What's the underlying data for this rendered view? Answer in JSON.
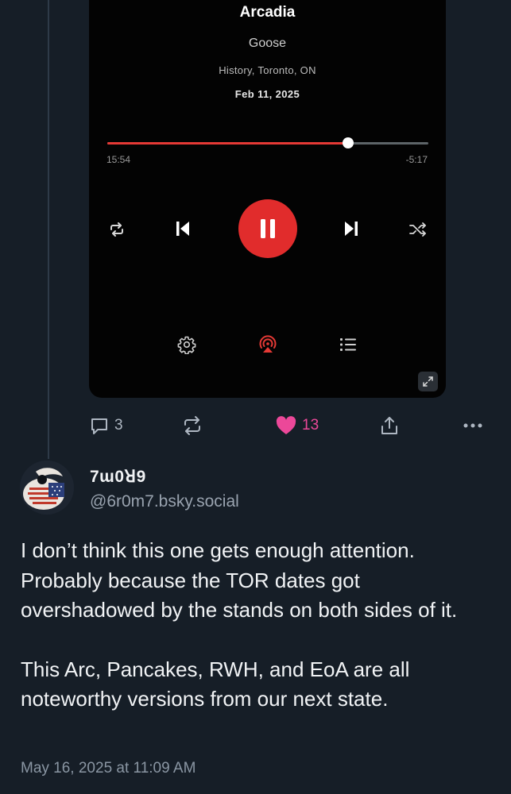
{
  "player": {
    "title": "Arcadia",
    "artist": "Goose",
    "venue": "History, Toronto, ON",
    "date": "Feb 11, 2025",
    "elapsed": "15:54",
    "remaining": "-5:17",
    "progress_fraction": 0.75,
    "playing": true,
    "accent_color": "#e12c2c",
    "controls": [
      "repeat-icon",
      "previous-icon",
      "pause-icon",
      "next-icon",
      "shuffle-icon"
    ],
    "secondary_controls": [
      "gear-icon",
      "airplay-icon",
      "queue-list-icon"
    ],
    "expand_icon": "expand-icon"
  },
  "actions": {
    "reply_count": "3",
    "repost_count": "",
    "like_count": "13",
    "liked": true,
    "like_color": "#ec4899",
    "icons": [
      "reply-icon",
      "repost-icon",
      "heart-icon",
      "share-icon",
      "more-icon"
    ]
  },
  "reply": {
    "display_name": "7ɯ0ꓤ9",
    "handle": "@6r0m7.bsky.social",
    "text_p1": "I don’t think this one gets enough attention. Probably because the TOR dates got overshadowed by the stands on both sides of it.",
    "text_p2": "This Arc, Pancakes, RWH, and EoA are all noteworthy versions from our next state.",
    "timestamp": "May 16, 2025 at 11:09 AM"
  }
}
